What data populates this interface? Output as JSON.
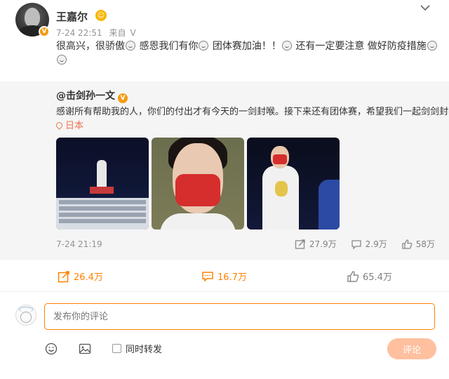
{
  "post": {
    "username": "王嘉尔",
    "date": "7-24 22:51",
    "source": "来自",
    "source_app": "V",
    "text_parts": [
      "很高兴，很骄傲",
      "感恩我们有你",
      "团体赛加油！！",
      "还有一定要注意 做好防疫措施",
      ""
    ]
  },
  "repost": {
    "author": "@击剑孙一文",
    "text": "感谢所有帮助我的人，你们的付出才有今天的一剑封喉。接下来还有团体赛，希望我们一起剑剑封喉。",
    "location": "日本",
    "time": "7-24 21:19",
    "repost_count": "27.9万",
    "comment_count": "2.9万",
    "like_count": "58万"
  },
  "actions": {
    "repost_count": "26.4万",
    "comment_count": "16.7万",
    "like_count": "65.4万"
  },
  "comment_box": {
    "placeholder": "发布你的评论",
    "repost_option_label": "同时转发",
    "submit_label": "评论"
  },
  "colors": {
    "accent": "#ff8200",
    "location": "#eb7350",
    "submit_disabled": "#ffc09f",
    "repost_bg": "#f5f5f5"
  },
  "icons": [
    "collapse-chevron-icon",
    "verified-badge-icon",
    "vip-badge-icon",
    "emoji-icon",
    "location-pin-icon",
    "repost-icon",
    "comment-icon",
    "like-icon",
    "emoji-picker-icon",
    "image-upload-icon"
  ]
}
